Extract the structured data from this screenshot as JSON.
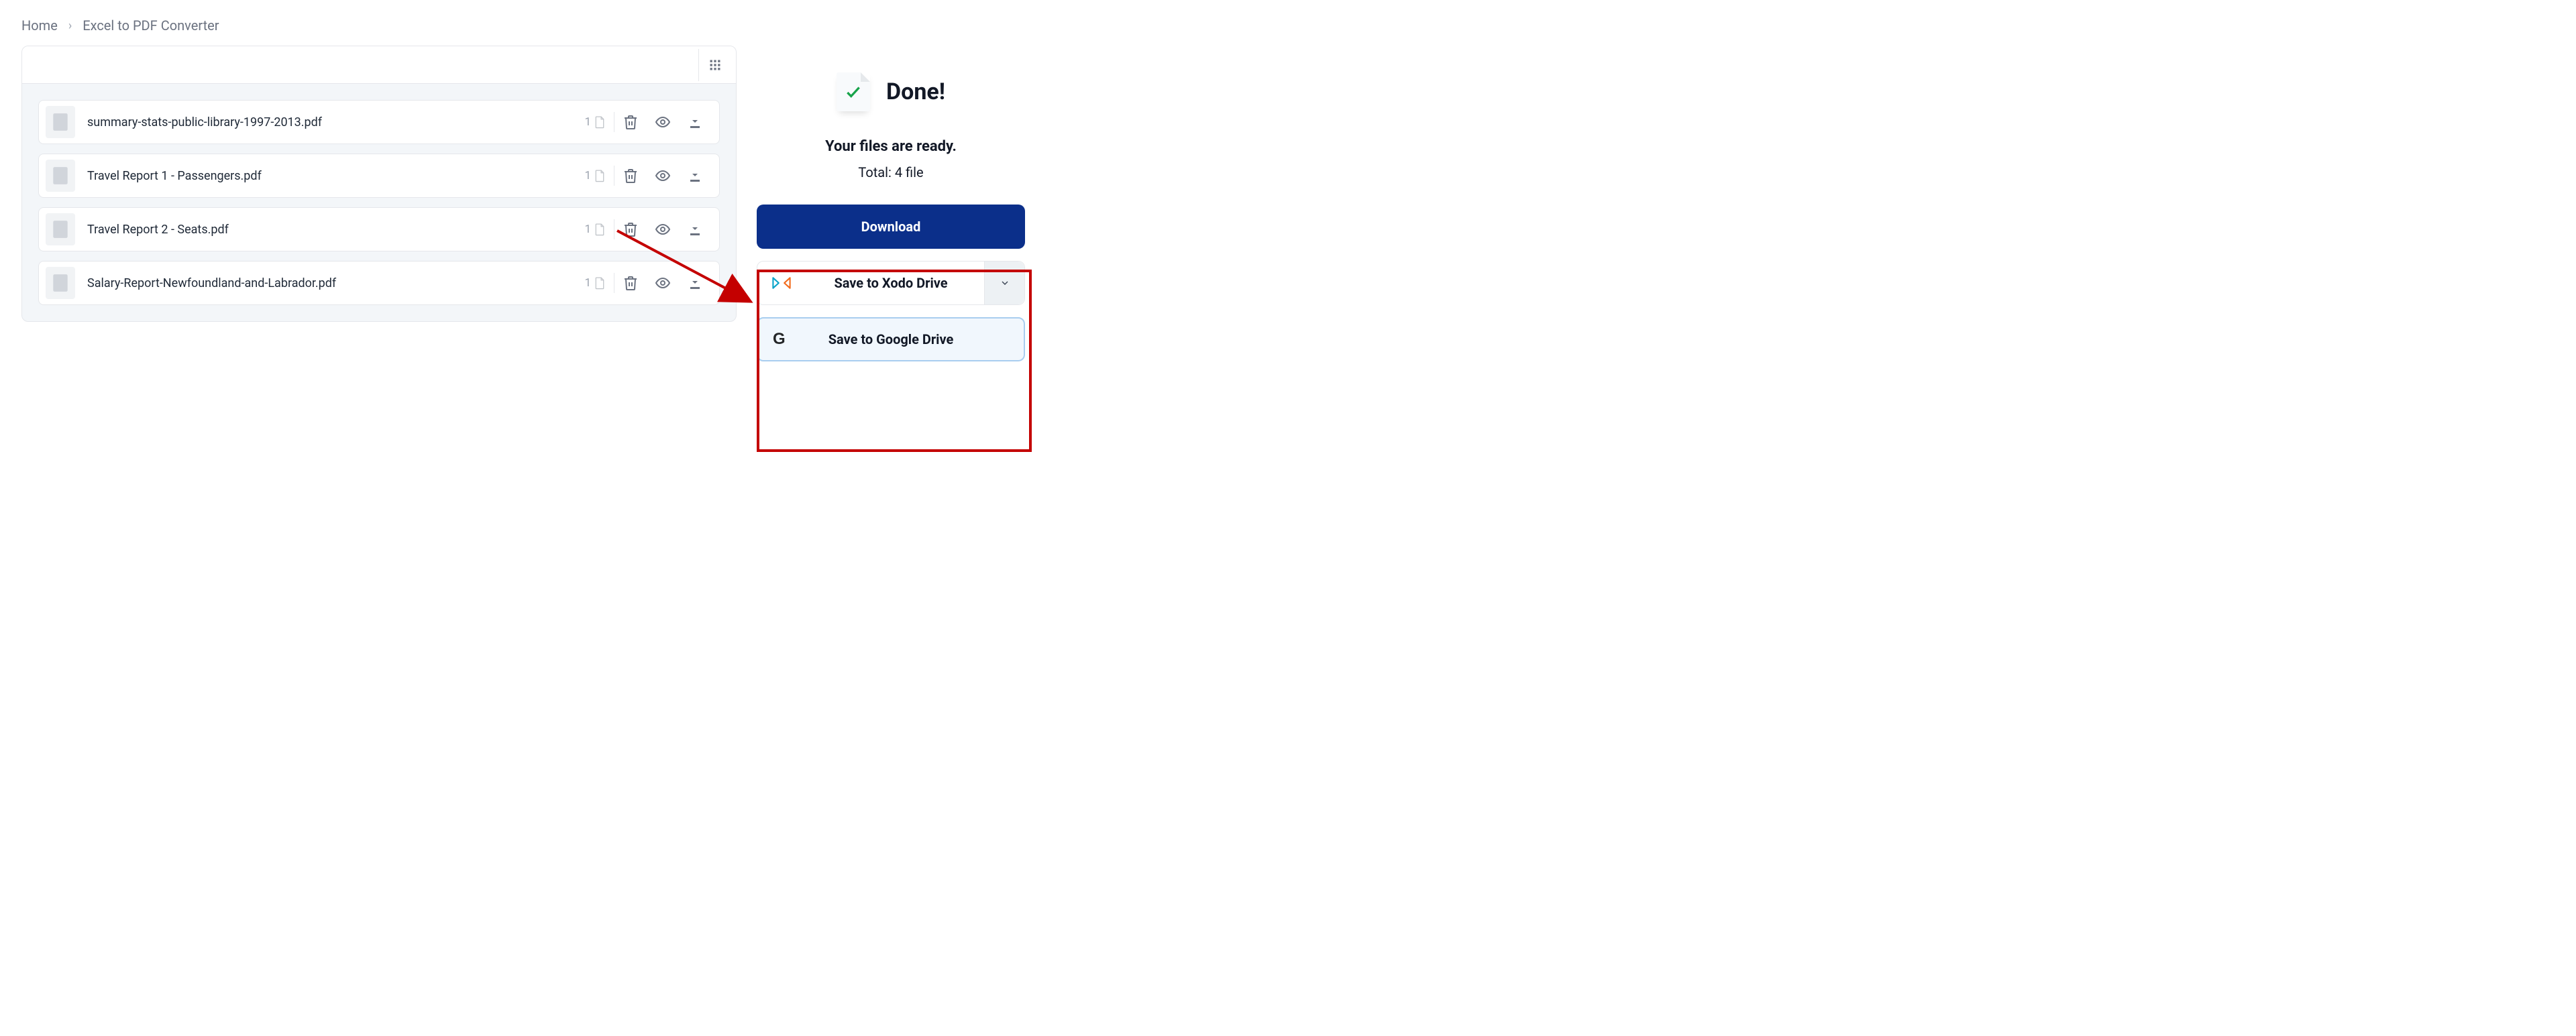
{
  "breadcrumb": {
    "home": "Home",
    "current": "Excel to PDF Converter"
  },
  "files": [
    {
      "name": "summary-stats-public-library-1997-2013.pdf",
      "pages": "1"
    },
    {
      "name": "Travel Report 1 - Passengers.pdf",
      "pages": "1"
    },
    {
      "name": "Travel Report 2 - Seats.pdf",
      "pages": "1"
    },
    {
      "name": "Salary-Report-Newfoundland-and-Labrador.pdf",
      "pages": "1"
    }
  ],
  "done": {
    "title": "Done!",
    "subtitle": "Your files are ready.",
    "total_label": "Total: 4 file"
  },
  "buttons": {
    "download": "Download",
    "save_xodo": "Save to Xodo Drive",
    "save_google": "Save to Google Drive"
  }
}
